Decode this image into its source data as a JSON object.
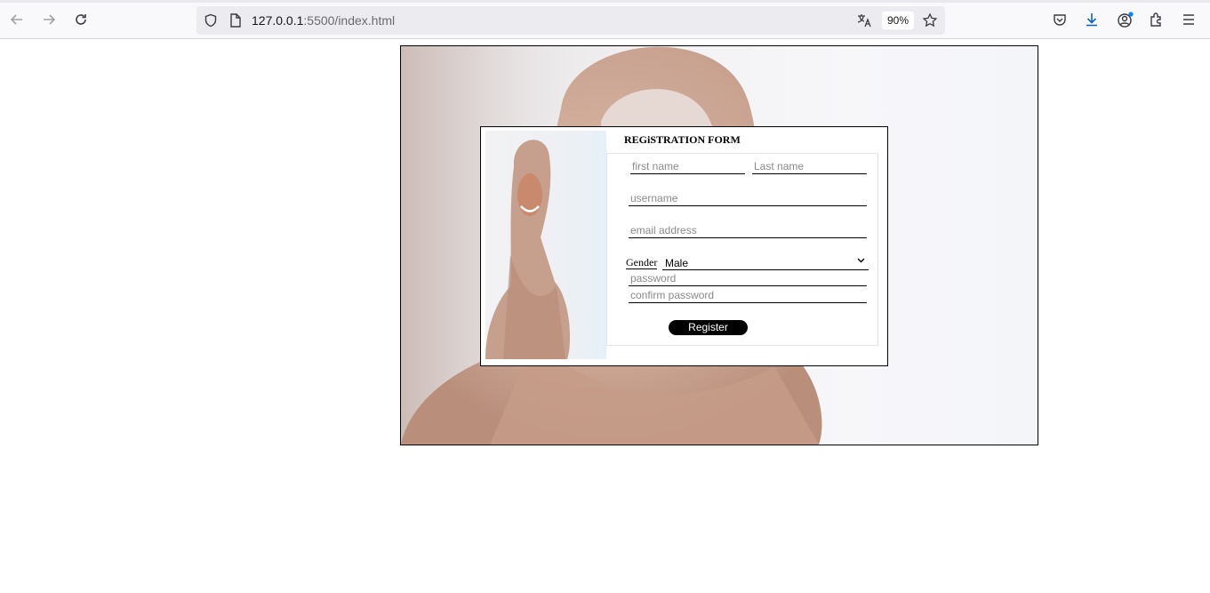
{
  "browser": {
    "url_host": "127.0.0.1",
    "url_path": ":5500/index.html",
    "zoom": "90%"
  },
  "form": {
    "title": "REGiSTRATION FORM",
    "first_name_placeholder": "first name",
    "last_name_placeholder": "Last name",
    "username_placeholder": "username",
    "email_placeholder": "email address",
    "gender_label": "Gender",
    "gender_value": "Male",
    "password_placeholder": "password",
    "confirm_password_placeholder": "confirm password",
    "register_label": "Register"
  },
  "colors": {
    "toolbar_bg": "#f9f9fb",
    "urlbar_bg": "#ececf0",
    "hijab_tone": "#c9a692",
    "button_bg": "#000000"
  }
}
